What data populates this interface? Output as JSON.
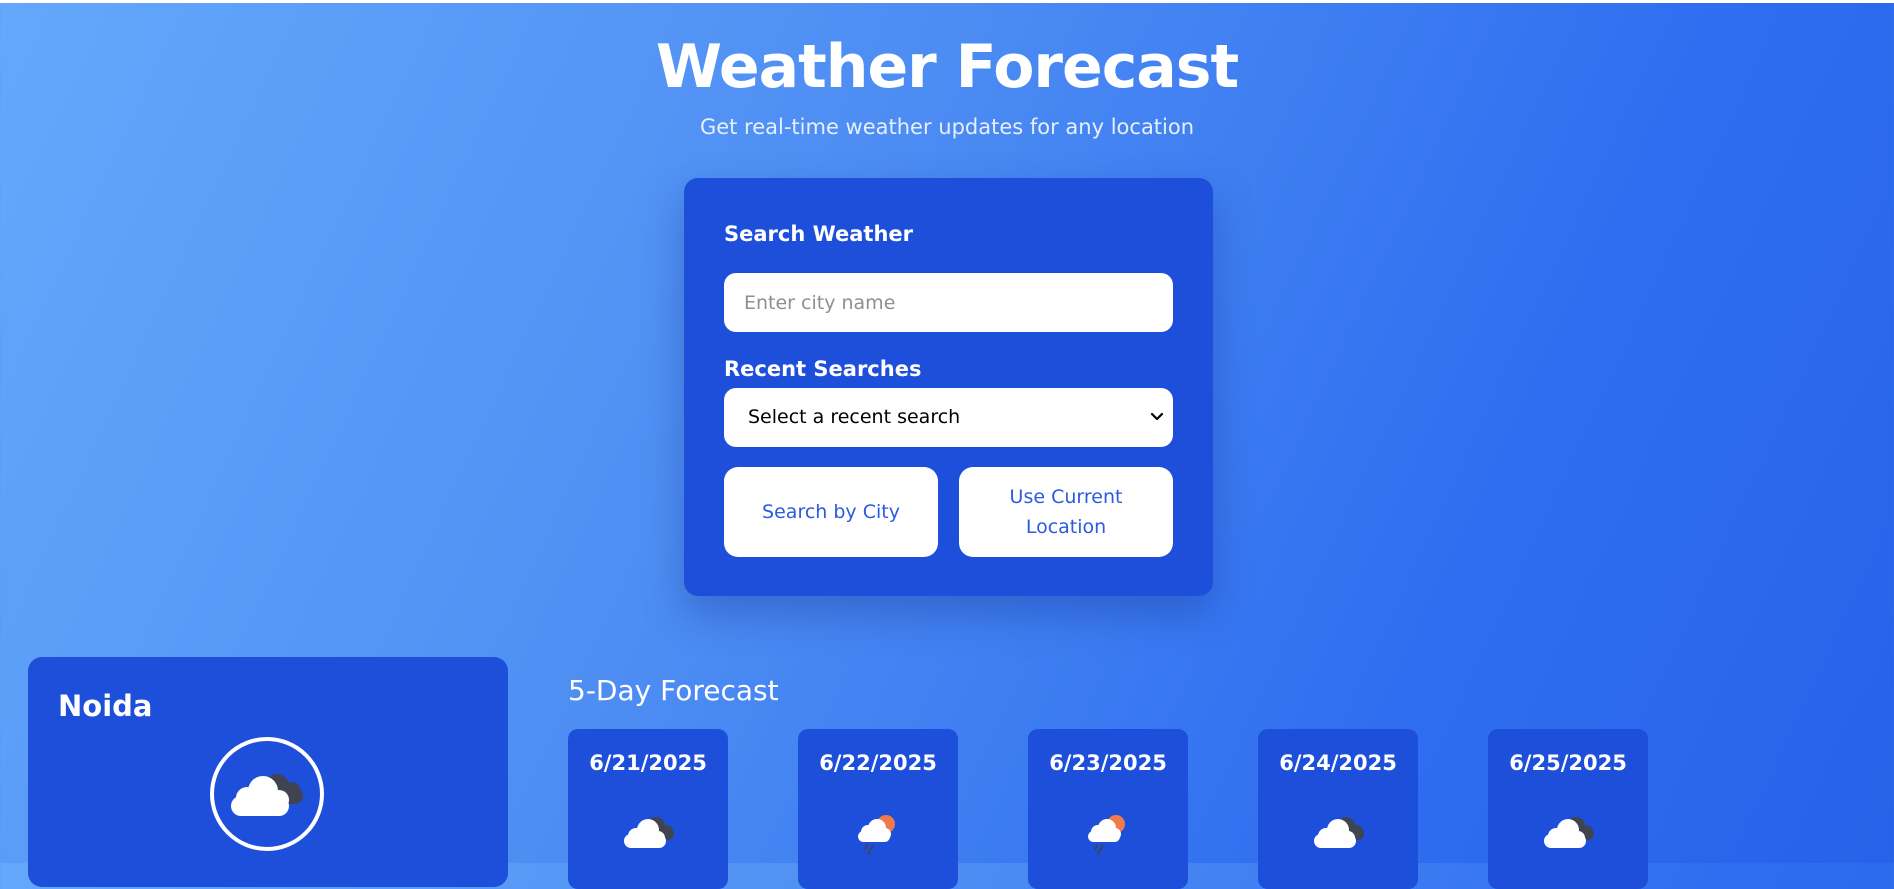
{
  "header": {
    "title": "Weather Forecast",
    "subtitle": "Get real-time weather updates for any location"
  },
  "search": {
    "section_label": "Search Weather",
    "city_input_placeholder": "Enter city name",
    "city_input_value": "",
    "recent_label": "Recent Searches",
    "recent_selected": "Select a recent search",
    "search_button": "Search by City",
    "location_button": "Use Current Location"
  },
  "current": {
    "city": "Noida",
    "icon": "cloudy-icon"
  },
  "forecast": {
    "title": "5-Day Forecast",
    "days": [
      {
        "date": "6/21/2025",
        "icon": "cloudy-icon"
      },
      {
        "date": "6/22/2025",
        "icon": "sun-rain-cloud-icon"
      },
      {
        "date": "6/23/2025",
        "icon": "sun-rain-cloud-icon"
      },
      {
        "date": "6/24/2025",
        "icon": "cloudy-icon"
      },
      {
        "date": "6/25/2025",
        "icon": "cloudy-icon"
      }
    ]
  },
  "colors": {
    "card_background": "#1e4fda",
    "button_text": "#2a5be0",
    "sun": "#ef7a4c"
  }
}
